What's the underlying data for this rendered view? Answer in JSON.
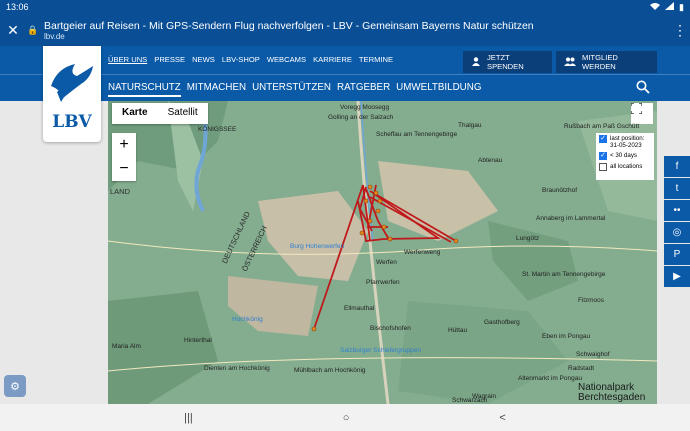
{
  "statusbar": {
    "time": "13:06",
    "icons": [
      "wifi-icon",
      "signal-icon",
      "battery-icon"
    ],
    "battery_glyph": "▮"
  },
  "tab": {
    "title": "Bartgeier auf Reisen - Mit GPS-Sendern Flug nachverfolgen - LBV - Gemeinsam Bayerns Natur schützen",
    "domain": "lbv.de",
    "close_glyph": "✕",
    "lock_glyph": "🔒",
    "menu_glyph": "⋮"
  },
  "logo": {
    "text": "LBV"
  },
  "toplinks": [
    "ÜBER UNS",
    "PRESSE",
    "NEWS",
    "LBV-SHOP",
    "WEBCAMS",
    "KARRIERE",
    "TERMINE"
  ],
  "buttons": {
    "spenden": "JETZT SPENDEN",
    "mitglied": "MITGLIED WERDEN"
  },
  "mainnav": [
    "NATURSCHUTZ",
    "MITMACHEN",
    "UNTERSTÜTZEN",
    "RATGEBER",
    "UMWELTBILDUNG"
  ],
  "map": {
    "toggle": {
      "karte": "Karte",
      "satellit": "Satellit"
    },
    "zoom_in": "+",
    "zoom_out": "−",
    "legend": {
      "last_position": "last position: 31-05-2023",
      "days": "< 30 days",
      "all": "all locations"
    },
    "labels": {
      "vorregg": "Voregg Moosegg",
      "golling": "Golling an der Salzach",
      "scheffau": "Scheffau am Tennengebirge",
      "thalgau": "Thalgau",
      "rusbach": "Rußbach am Paß Gschütt",
      "konigssee": "KÖNIGSSEE",
      "abtenau": "Abtenau",
      "braunotzhof": "Braunötzhof",
      "annaberg": "Annaberg im Lammertal",
      "lungotz": "Lungötz",
      "stmartin": "St. Martin am Tennengebirge",
      "filzmoos": "Filzmoos",
      "werfen": "Werfen",
      "werfenweng": "Werfenweng",
      "burg": "Burg Hohenwerfen",
      "pfarrwerfen": "Pfarrwerfen",
      "ellmau": "Ellmauthal",
      "hochkonig": "Hochkönig",
      "bischofs": "Bischofshofen",
      "huttau": "Hüttau",
      "gasthof": "Gasthofberg",
      "eben": "Eben im Pongau",
      "maria_alm": "Maria Alm",
      "hinterthal": "Hinterthal",
      "dienten": "Dienten am Hochkönig",
      "muhlbach": "Mühlbach am Hochkönig",
      "salzburger": "Salzburger Schiefergruppen",
      "schwaighof": "Schwaighof",
      "radstadt": "Radstadt",
      "altenmarkt": "Altenmarkt im Pongau",
      "wagrain": "Wagrain",
      "schwarzach": "Schwarzach",
      "deutschland": "DEUTSCHLAND",
      "osterreich": "ÖSTERREICH",
      "land": "LAND"
    },
    "np": {
      "line1": "Nationalpark",
      "line2": "Berchtesgaden"
    }
  },
  "social": [
    "f",
    "t",
    "••",
    "◎",
    "P",
    "▶"
  ],
  "cookie_glyph": "⚙",
  "android_nav": [
    "|||",
    "○",
    "<"
  ],
  "colors": {
    "header_blue": "#0a5aa8",
    "track_red": "#c0191b",
    "map_green": "#7ea98a"
  }
}
